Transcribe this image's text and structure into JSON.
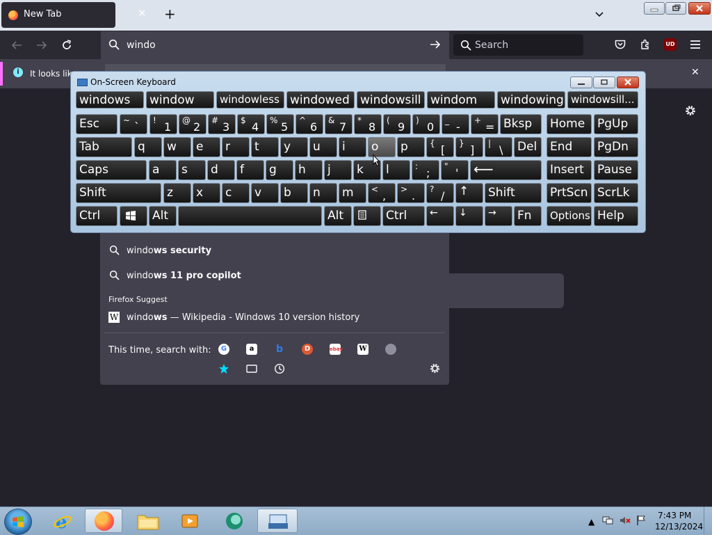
{
  "browser": {
    "tab_title": "New Tab",
    "tab_close": "✕",
    "new_tab": "+",
    "url_text": "windo",
    "search_placeholder": "Search",
    "ublock_label": "UD",
    "infobar_text": "It looks like",
    "infobar_close": "✕"
  },
  "dropdown": {
    "suggestions": [
      {
        "prefix": "windo",
        "bold": "ws security"
      },
      {
        "prefix": "windo",
        "bold": "ws 11 pro copilot"
      }
    ],
    "firefox_suggest_header": "Firefox Suggest",
    "wiki": {
      "prefix": "windo",
      "bold": "ws",
      "rest": " — Wikipedia - Windows 10 version history",
      "icon": "W"
    },
    "search_with_label": "This time, search with:"
  },
  "osk": {
    "title": "On-Screen Keyboard",
    "predictions": [
      "windows",
      "window",
      "windowless",
      "windowed",
      "windowsill",
      "windom",
      "windowing",
      "windowsill..."
    ],
    "row1": [
      {
        "m": "Esc"
      },
      {
        "s": "~",
        "b": "`"
      },
      {
        "s": "!",
        "b": "1"
      },
      {
        "s": "@",
        "b": "2"
      },
      {
        "s": "#",
        "b": "3"
      },
      {
        "s": "$",
        "b": "4"
      },
      {
        "s": "%",
        "b": "5"
      },
      {
        "s": "^",
        "b": "6"
      },
      {
        "s": "&",
        "b": "7"
      },
      {
        "s": "*",
        "b": "8"
      },
      {
        "s": "(",
        "b": "9"
      },
      {
        "s": ")",
        "b": "0"
      },
      {
        "s": "_",
        "b": "-"
      },
      {
        "s": "+",
        "b": "="
      },
      {
        "m": "Bksp"
      },
      {
        "m": "Home"
      },
      {
        "m": "PgUp"
      }
    ],
    "row2": [
      "Tab",
      "q",
      "w",
      "e",
      "r",
      "t",
      "y",
      "u",
      "i",
      "o",
      "p",
      "{[",
      "}]",
      "|\\",
      "Del",
      "End",
      "PgDn"
    ],
    "row2_brackets": [
      {
        "s": "{",
        "b": "["
      },
      {
        "s": "}",
        "b": "]"
      },
      {
        "s": "|",
        "b": "\\"
      }
    ],
    "row3": [
      "Caps",
      "a",
      "s",
      "d",
      "f",
      "g",
      "h",
      "j",
      "k",
      "l",
      "",
      "",
      "",
      "Insert",
      "Pause"
    ],
    "row3_punct": [
      {
        "s": ":",
        "b": ";"
      },
      {
        "s": "\"",
        "b": "'"
      }
    ],
    "row3_enter": "⟵",
    "row4": [
      "Shift",
      "z",
      "x",
      "c",
      "v",
      "b",
      "n",
      "m",
      "",
      "",
      "",
      "↑",
      "Shift",
      "PrtScn",
      "ScrLk"
    ],
    "row4_punct": [
      {
        "s": "<",
        "b": ","
      },
      {
        "s": ">",
        "b": "."
      },
      {
        "s": "?",
        "b": "/"
      }
    ],
    "row5": [
      "Ctrl",
      "",
      "Alt",
      "",
      "Alt",
      "",
      "Ctrl",
      "←",
      "↓",
      "→",
      "Fn",
      "Options",
      "Help"
    ]
  },
  "taskbar": {
    "time": "7:43 PM",
    "date": "12/13/2024",
    "tray_arrow": "▲"
  }
}
